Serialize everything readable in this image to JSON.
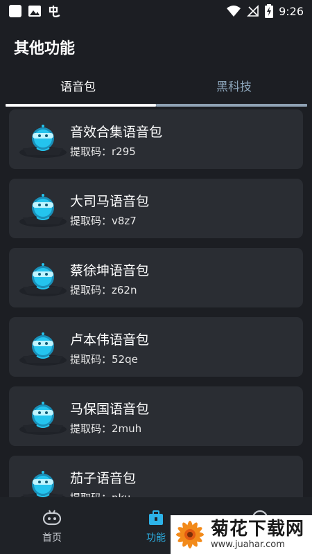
{
  "status_bar": {
    "time": "9:26",
    "left_icons": [
      "app-square-icon",
      "image-icon",
      "app-glyph-icon"
    ],
    "right_icons": [
      "wifi-icon",
      "no-signal-icon",
      "battery-charging-icon"
    ]
  },
  "header": {
    "title": "其他功能"
  },
  "tabs": [
    {
      "label": "语音包",
      "active": true
    },
    {
      "label": "黑科技",
      "active": false
    }
  ],
  "cards": [
    {
      "title": "音效合集语音包",
      "code_label": "提取码：",
      "code": "r295"
    },
    {
      "title": "大司马语音包",
      "code_label": "提取码：",
      "code": "v8z7"
    },
    {
      "title": "蔡徐坤语音包",
      "code_label": "提取码：",
      "code": "z62n"
    },
    {
      "title": "卢本伟语音包",
      "code_label": "提取码：",
      "code": "52qe"
    },
    {
      "title": "马保国语音包",
      "code_label": "提取码：",
      "code": "2muh"
    },
    {
      "title": "茄子语音包",
      "code_label": "提取码：",
      "code": "nku"
    }
  ],
  "bottom_nav": [
    {
      "label": "首页",
      "icon": "gamepad-icon",
      "active": false
    },
    {
      "label": "功能",
      "icon": "toolbox-icon",
      "active": true
    },
    {
      "label": "",
      "icon": "profile-icon",
      "active": false
    }
  ],
  "colors": {
    "accent": "#2db3e8",
    "background": "#1c1e23",
    "card": "#2a2d33"
  },
  "watermark": {
    "title": "菊花下载网",
    "url": "www.juahar.com"
  }
}
